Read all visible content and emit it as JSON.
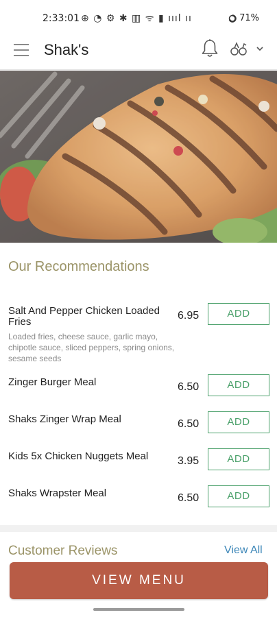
{
  "status_bar": {
    "time": "2:33:01",
    "icons": "⊕   ◔ ⚙ ✱ ▥ ᯤ ▮ ıııl ıı",
    "battery": "71%"
  },
  "header": {
    "title": "Shak's",
    "icons": [
      "menu-icon",
      "bell-icon",
      "diet-icon",
      "chevron-down-icon"
    ]
  },
  "recommendations": {
    "title": "Our Recommendations",
    "add_label": "ADD",
    "items": [
      {
        "name": "Salt And Pepper Chicken Loaded Fries",
        "description": "Loaded fries, cheese sauce, garlic mayo, chipotle sauce, sliced peppers, spring onions, sesame seeds",
        "price": "6.95"
      },
      {
        "name": "Zinger Burger Meal",
        "description": "",
        "price": "6.50"
      },
      {
        "name": "Shaks Zinger Wrap Meal",
        "description": "",
        "price": "6.50"
      },
      {
        "name": "Kids 5x Chicken Nuggets Meal",
        "description": "",
        "price": "3.95"
      },
      {
        "name": "Shaks Wrapster Meal",
        "description": "",
        "price": "6.50"
      }
    ]
  },
  "reviews": {
    "title": "Customer Reviews",
    "view_all": "View All"
  },
  "footer": {
    "view_menu_label": "VIEW MENU"
  },
  "colors": {
    "accent_button": "#b85c46",
    "add_green": "#4aa06a",
    "section_title": "#9b9468",
    "link_blue": "#3d87b8"
  }
}
